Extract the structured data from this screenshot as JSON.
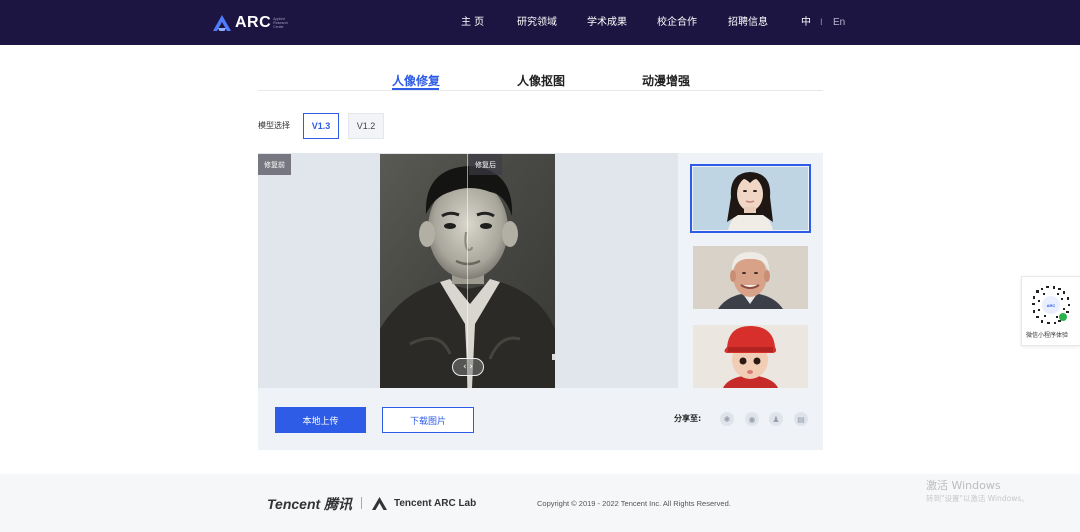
{
  "header": {
    "logo_text": "ARC",
    "logo_sub": [
      "Applied",
      "Research",
      "Center"
    ],
    "nav": [
      "主 页",
      "研究领域",
      "学术成果",
      "校企合作",
      "招聘信息"
    ],
    "lang_cn": "中",
    "lang_sep": "I",
    "lang_en": "En"
  },
  "tabs": [
    "人像修复",
    "人像抠图",
    "动漫增强"
  ],
  "active_tab": 0,
  "model": {
    "label": "模型选择",
    "options": [
      "V1.3",
      "V1.2"
    ],
    "selected": "V1.3"
  },
  "viewer": {
    "before_tag": "修复前",
    "after_tag": "修复后",
    "handle_icon": "‹ ›",
    "split_position": 0.5
  },
  "thumbnails": [
    "woman-portrait",
    "older-man-portrait",
    "baby-in-red-hat"
  ],
  "selected_thumbnail": 0,
  "actions": {
    "upload": "本地上传",
    "download": "下载图片"
  },
  "share": {
    "label": "分享至:",
    "icons": [
      "qzone-icon",
      "weibo-icon",
      "qq-icon",
      "douban-icon"
    ]
  },
  "qr": {
    "caption": "微信小程序体验"
  },
  "footer": {
    "tencent": "Tencent 腾讯",
    "sep": "|",
    "lab": "Tencent ARC Lab",
    "copyright": "Copyright © 2019 - 2022 Tencent Inc. All Rights Reserved."
  },
  "watermark": {
    "line1": "激活 Windows",
    "line2": "转到\"设置\"以激活 Windows。"
  },
  "colors": {
    "header_bg": "#1c1541",
    "accent": "#2f5ce6",
    "panel_bg": "#eff2f7"
  }
}
